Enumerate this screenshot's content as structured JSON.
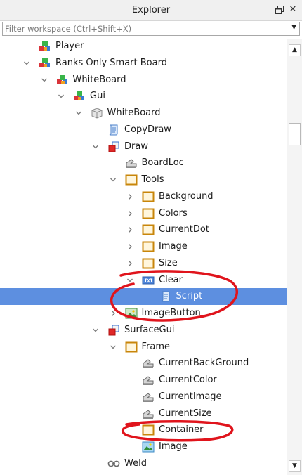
{
  "window": {
    "title": "Explorer",
    "controls": {
      "undock_icon": "restore-window-icon",
      "close_glyph": "✕"
    }
  },
  "filter": {
    "placeholder": "Filter workspace (Ctrl+Shift+X)",
    "value": ""
  },
  "tree": [
    {
      "label": "Player",
      "icon": "model",
      "depth": 1,
      "arrow": "none"
    },
    {
      "label": "Ranks Only Smart Board",
      "icon": "model",
      "depth": 1,
      "arrow": "down"
    },
    {
      "label": "WhiteBoard",
      "icon": "model",
      "depth": 2,
      "arrow": "down"
    },
    {
      "label": "Gui",
      "icon": "model",
      "depth": 3,
      "arrow": "down"
    },
    {
      "label": "WhiteBoard",
      "icon": "part",
      "depth": 4,
      "arrow": "down"
    },
    {
      "label": "CopyDraw",
      "icon": "script",
      "depth": 5,
      "arrow": "none"
    },
    {
      "label": "Draw",
      "icon": "surfacegui",
      "depth": 5,
      "arrow": "down"
    },
    {
      "label": "BoardLoc",
      "icon": "value",
      "depth": 6,
      "arrow": "none"
    },
    {
      "label": "Tools",
      "icon": "frame",
      "depth": 6,
      "arrow": "down"
    },
    {
      "label": "Background",
      "icon": "frame",
      "depth": 7,
      "arrow": "right"
    },
    {
      "label": "Colors",
      "icon": "frame",
      "depth": 7,
      "arrow": "right"
    },
    {
      "label": "CurrentDot",
      "icon": "frame",
      "depth": 7,
      "arrow": "right"
    },
    {
      "label": "Image",
      "icon": "frame",
      "depth": 7,
      "arrow": "right"
    },
    {
      "label": "Size",
      "icon": "frame",
      "depth": 7,
      "arrow": "right"
    },
    {
      "label": "Clear",
      "icon": "textbutton",
      "depth": 7,
      "arrow": "down"
    },
    {
      "label": "Script",
      "icon": "script",
      "depth": 8,
      "arrow": "none",
      "selected": true
    },
    {
      "label": "ImageButton",
      "icon": "imagebutton",
      "depth": 6,
      "arrow": "right"
    },
    {
      "label": "SurfaceGui",
      "icon": "surfacegui",
      "depth": 5,
      "arrow": "down"
    },
    {
      "label": "Frame",
      "icon": "frame",
      "depth": 6,
      "arrow": "down"
    },
    {
      "label": "CurrentBackGround",
      "icon": "value",
      "depth": 7,
      "arrow": "none"
    },
    {
      "label": "CurrentColor",
      "icon": "value",
      "depth": 7,
      "arrow": "none"
    },
    {
      "label": "CurrentImage",
      "icon": "value",
      "depth": 7,
      "arrow": "none"
    },
    {
      "label": "CurrentSize",
      "icon": "value",
      "depth": 7,
      "arrow": "none"
    },
    {
      "label": "Container",
      "icon": "frame",
      "depth": 7,
      "arrow": "none"
    },
    {
      "label": "Image",
      "icon": "imagelabel",
      "depth": 7,
      "arrow": "none"
    },
    {
      "label": "Weld",
      "icon": "weld",
      "depth": 5,
      "arrow": "none"
    }
  ],
  "scrollbar": {
    "up_glyph": "▲",
    "down_glyph": "▼"
  },
  "colors": {
    "selection": "#5d8fe0",
    "annotation": "#e0141c"
  }
}
